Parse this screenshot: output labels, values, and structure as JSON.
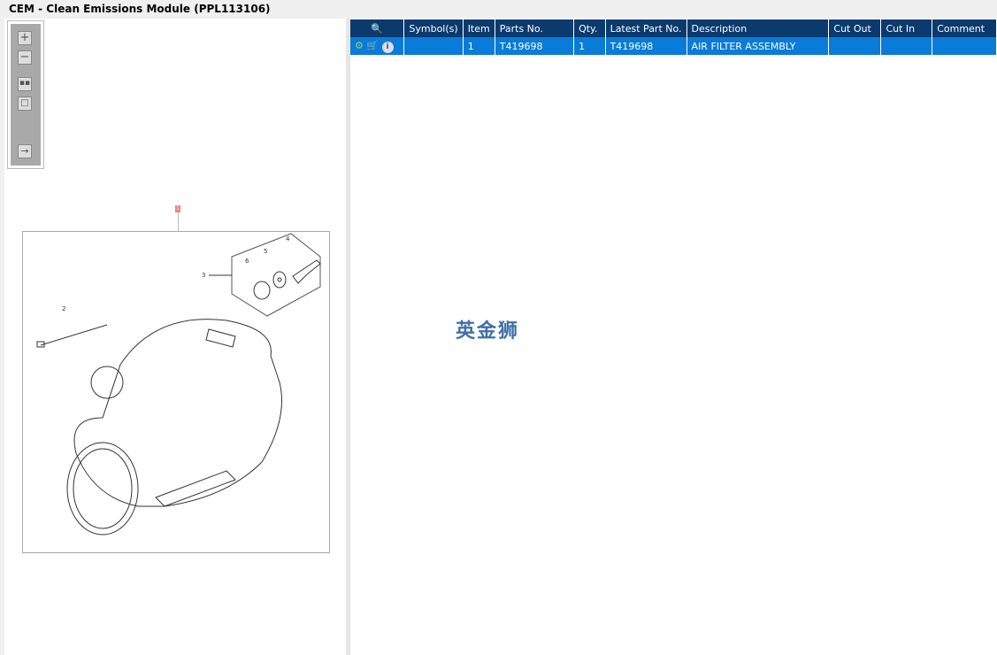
{
  "window": {
    "title": "CEM - Clean Emissions Module (PPL113106)"
  },
  "toolbar": {
    "buttons": [
      "zoom-in",
      "zoom-out",
      "fit-all",
      "actual-size",
      "export"
    ]
  },
  "drawing": {
    "callout": "1",
    "labels": [
      "2",
      "3",
      "4",
      "5",
      "6"
    ]
  },
  "table": {
    "columns": [
      "",
      "Symbol(s)",
      "Item",
      "Parts No.",
      "Qty.",
      "Latest Part No.",
      "Description",
      "Cut Out",
      "Cut In",
      "Comment"
    ],
    "rows": [
      {
        "symbols": "",
        "item": "1",
        "part_no": "T419698",
        "qty": "1",
        "latest_part_no": "T419698",
        "description": "AIR FILTER ASSEMBLY",
        "cut_out": "",
        "cut_in": "",
        "comment": ""
      }
    ]
  },
  "watermark": "英金狮"
}
